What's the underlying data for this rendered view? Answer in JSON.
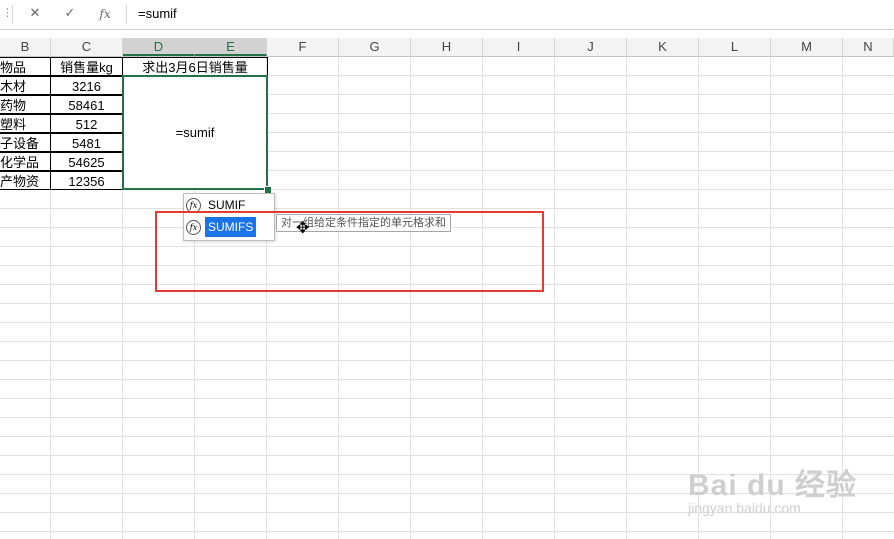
{
  "formula_bar": {
    "cancel_icon": "✕",
    "enter_icon": "✓",
    "fx_label": "fx",
    "formula": "=sumif"
  },
  "columns": [
    "B",
    "C",
    "D",
    "E",
    "F",
    "G",
    "H",
    "I",
    "J",
    "K",
    "L",
    "M",
    "N"
  ],
  "table": {
    "header_b": "物品",
    "header_c": "销售量kg",
    "header_de": "求出3月6日销售量",
    "rows": [
      {
        "item": "木材",
        "qty": "3216"
      },
      {
        "item": "药物",
        "qty": "58461"
      },
      {
        "item": "塑料",
        "qty": "512"
      },
      {
        "item": "子设备",
        "qty": "5481"
      },
      {
        "item": "化学品",
        "qty": "54625"
      },
      {
        "item": "产物资",
        "qty": "12356"
      }
    ]
  },
  "merged_cell_text": "=sumif",
  "autocomplete": {
    "items": [
      {
        "label": "SUMIF",
        "icon": "fx-function-icon"
      },
      {
        "label": "SUMIFS",
        "icon": "fx-function-icon"
      }
    ],
    "tooltip": "对一组给定条件指定的单元格求和"
  },
  "watermark": {
    "brand": "Bai du 经验",
    "url": "jingyan.baidu.com"
  },
  "colors": {
    "accent": "#217346",
    "highlight": "#1a73e8",
    "annotation": "#e53935"
  }
}
